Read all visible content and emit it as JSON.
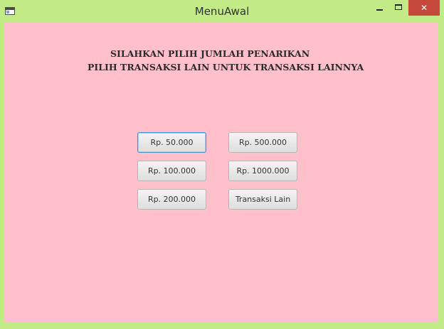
{
  "window": {
    "title": "MenuAwal",
    "close_glyph": "✕"
  },
  "content": {
    "heading_line1": "SILAHKAN PILIH JUMLAH PENARIKAN",
    "heading_line2": "PILIH TRANSAKSI LAIN UNTUK TRANSAKSI LAINNYA",
    "buttons": {
      "b50": "Rp. 50.000",
      "b500": "Rp. 500.000",
      "b100": "Rp. 100.000",
      "b1000": "Rp. 1000.000",
      "b200": "Rp. 200.000",
      "other": "Transaksi Lain"
    }
  },
  "colors": {
    "titlebar": "#c2ea86",
    "content_bg": "#ffc0cb",
    "close_button": "#c7493c"
  }
}
